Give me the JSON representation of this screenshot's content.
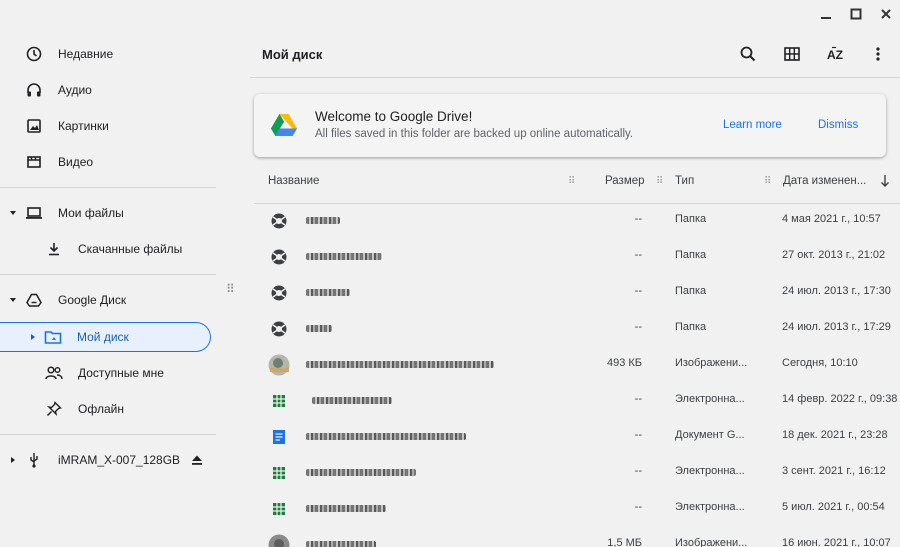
{
  "window": {
    "minimize_icon": "minimize-icon",
    "maximize_icon": "maximize-icon",
    "close_icon": "close-icon"
  },
  "sidebar": {
    "items": [
      {
        "label": "Недавние",
        "icon": "clock-icon"
      },
      {
        "label": "Аудио",
        "icon": "headphones-icon"
      },
      {
        "label": "Картинки",
        "icon": "image-icon"
      },
      {
        "label": "Видео",
        "icon": "video-icon"
      },
      {
        "label": "Мои файлы",
        "icon": "laptop-icon"
      },
      {
        "label": "Скачанные файлы",
        "icon": "download-icon"
      },
      {
        "label": "Google Диск",
        "icon": "drive-icon"
      },
      {
        "label": "Мой диск",
        "icon": "folder-drive-icon"
      },
      {
        "label": "Доступные мне",
        "icon": "people-icon"
      },
      {
        "label": "Офлайн",
        "icon": "pin-icon"
      },
      {
        "label": "iMRAM_X-007_128GB",
        "icon": "usb-icon"
      }
    ]
  },
  "header": {
    "title": "Мой диск"
  },
  "banner": {
    "title": "Welcome to Google Drive!",
    "subtitle": "All files saved in this folder are backed up online automatically.",
    "learn_more": "Learn more",
    "dismiss": "Dismiss"
  },
  "table": {
    "columns": {
      "name": "Название",
      "size": "Размер",
      "type": "Тип",
      "date": "Дата изменен..."
    },
    "rows": [
      {
        "size": "--",
        "type": "Папка",
        "date": "4 мая 2021 г., 10:57",
        "icon": "shared-folder-icon"
      },
      {
        "size": "--",
        "type": "Папка",
        "date": "27 окт. 2013 г., 21:02",
        "icon": "shared-folder-icon"
      },
      {
        "size": "--",
        "type": "Папка",
        "date": "24 июл. 2013 г., 17:30",
        "icon": "shared-folder-icon"
      },
      {
        "size": "--",
        "type": "Папка",
        "date": "24 июл. 2013 г., 17:29",
        "icon": "shared-folder-icon"
      },
      {
        "size": "493 КБ",
        "type": "Изображени...",
        "date": "Сегодня, 10:10",
        "icon": "image-thumbnail-icon"
      },
      {
        "size": "--",
        "type": "Электронна...",
        "date": "14 февр. 2022 г., 09:38",
        "icon": "spreadsheet-icon"
      },
      {
        "size": "--",
        "type": "Документ G...",
        "date": "18 дек. 2021 г., 23:28",
        "icon": "document-icon"
      },
      {
        "size": "--",
        "type": "Электронна...",
        "date": "3 сент. 2021 г., 16:12",
        "icon": "spreadsheet-icon"
      },
      {
        "size": "--",
        "type": "Электронна...",
        "date": "5 июл. 2021 г., 00:54",
        "icon": "spreadsheet-icon"
      },
      {
        "size": "1,5 МБ",
        "type": "Изображени...",
        "date": "16 июн. 2021 г., 10:07",
        "icon": "image-thumbnail-icon"
      }
    ]
  }
}
